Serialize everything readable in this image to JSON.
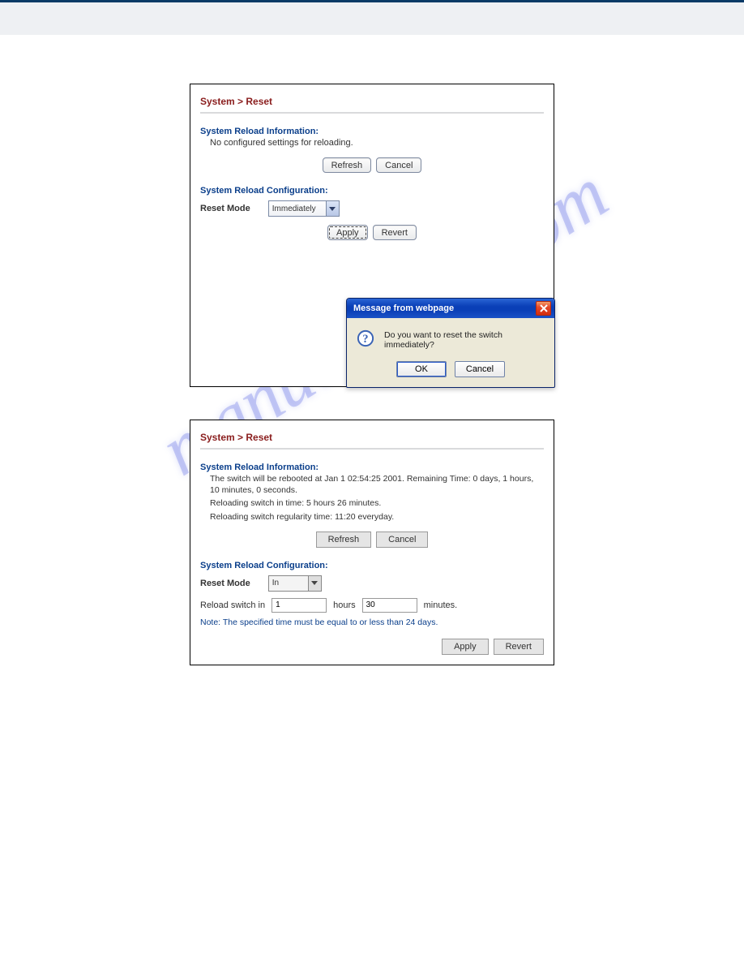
{
  "watermark_text": "manualshive.com",
  "figure1": {
    "breadcrumb": "System > Reset",
    "reload_info_heading": "System Reload Information:",
    "reload_info_text": "No configured settings for reloading.",
    "btn_refresh": "Refresh",
    "btn_cancel": "Cancel",
    "reload_config_heading": "System Reload Configuration:",
    "reset_mode_label": "Reset Mode",
    "reset_mode_value": "Immediately",
    "btn_apply": "Apply",
    "btn_revert": "Revert",
    "dialog": {
      "title": "Message from webpage",
      "message": "Do you want to reset the switch immediately?",
      "ok": "OK",
      "cancel": "Cancel"
    }
  },
  "figure2": {
    "breadcrumb": "System > Reset",
    "reload_info_heading": "System Reload Information:",
    "info_line1": "The switch will be rebooted at Jan 1 02:54:25 2001. Remaining Time: 0 days, 1 hours, 10 minutes, 0 seconds.",
    "info_line2": "Reloading switch in time: 5 hours 26 minutes.",
    "info_line3": "Reloading switch regularity time: 11:20 everyday.",
    "btn_refresh": "Refresh",
    "btn_cancel": "Cancel",
    "reload_config_heading": "System Reload Configuration:",
    "reset_mode_label": "Reset Mode",
    "reset_mode_value": "In",
    "reload_switch_in_label": "Reload switch in",
    "hours_value": "1",
    "hours_label": "hours",
    "minutes_value": "30",
    "minutes_label": "minutes.",
    "note": "Note: The specified time must be equal to or less than 24 days.",
    "btn_apply": "Apply",
    "btn_revert": "Revert"
  }
}
